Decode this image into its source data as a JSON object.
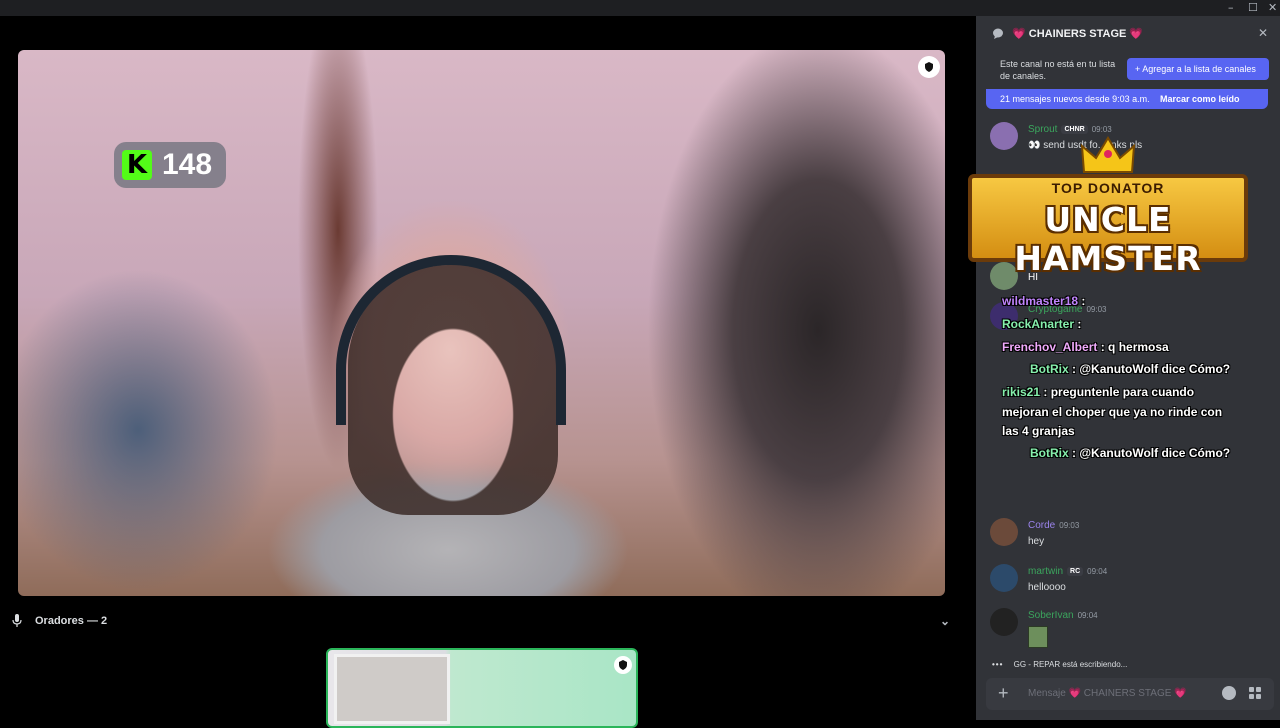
{
  "window": {
    "minimize": "–",
    "maximize": "☐",
    "close": "✕"
  },
  "stage": {
    "kick_count": "148",
    "kick_logo": "K",
    "speakers_label": "Oradores — 2"
  },
  "sidebar": {
    "channel_title": "💗 CHAINERS STAGE 💗",
    "notice": "Este canal no está en tu lista de canales.",
    "add_button": "+ Agregar a la lista de canales",
    "new_messages": "21 mensajes nuevos desde 9:03 a.m.",
    "mark_read": "Marcar como leído",
    "messages": [
      {
        "user": "Sprout",
        "tag": "CHNR",
        "time": "09:03",
        "text": "👀 send usdt fo... inks pls",
        "color": "#3ba55d"
      },
      {
        "user": "Cryptogame",
        "time": "09:03",
        "text": "",
        "color": "#3ba55d"
      },
      {
        "user": "Corde",
        "time": "09:03",
        "text": "hey",
        "color": "#7d6bd6"
      },
      {
        "user": "martwin",
        "tag": "RC",
        "time": "09:04",
        "text": "helloooo",
        "color": "#3ba55d"
      },
      {
        "user": "SoberIvan",
        "time": "09:04",
        "text": "",
        "color": "#3ba55d"
      }
    ],
    "hi_text": "HI",
    "typing": "GG - REPAR está escribiendo...",
    "composer_placeholder": "Mensaje 💗 CHAINERS STAGE 💗"
  },
  "overlay": {
    "donator_top": "TOP DONATOR",
    "donator_name": "UNCLE HAMSTER",
    "chat_lines": [
      {
        "user": "wildmaster18",
        "text": " :",
        "user_color": "#c084fc"
      },
      {
        "user": "RockAnarter",
        "text": " :",
        "user_color": "#86efac"
      },
      {
        "user": "Frenchov_Albert",
        "text": " : q hermosa",
        "user_color": "#f0abfc"
      },
      {
        "user": "BotRix",
        "text": " : @KanutoWolf dice Cómo?",
        "user_color": "#86efac"
      },
      {
        "user": "rikis21",
        "text": " : preguntenle para cuando",
        "user_color": "#86efac"
      },
      {
        "user": "",
        "text": "mejoran el choper que ya no rinde con",
        "user_color": "#fff"
      },
      {
        "user": "",
        "text": "las 4 granjas",
        "user_color": "#fff"
      },
      {
        "user": "BotRix",
        "text": " : @KanutoWolf dice Cómo?",
        "user_color": "#86efac"
      }
    ]
  },
  "colors": {
    "accent": "#5865f2",
    "kick_green": "#53fc18",
    "sidebar_bg": "#313338"
  }
}
